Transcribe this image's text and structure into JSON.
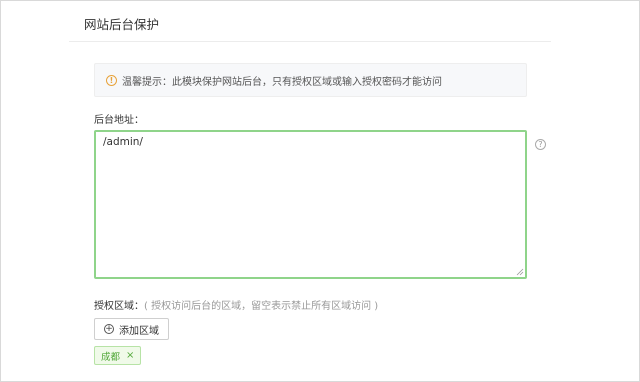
{
  "page": {
    "title": "网站后台保护"
  },
  "notice": {
    "icon": "warning-icon",
    "icon_glyph": "!",
    "text": "温馨提示：此模块保护网站后台，只有授权区域或输入授权密码才能访问"
  },
  "admin_address": {
    "label": "后台地址：",
    "value": "/admin/",
    "help_glyph": "?"
  },
  "authorized_regions": {
    "label": "授权区域：",
    "hint": "( 授权访问后台的区域，留空表示禁止所有区域访问 )",
    "add_button_label": "添加区域",
    "add_glyph": "+",
    "tags": [
      {
        "label": "成都",
        "close_glyph": "×"
      }
    ]
  },
  "colors": {
    "accent_green": "#8fd48a",
    "tag_green": "#52a839",
    "warning_orange": "#e8a33b"
  }
}
